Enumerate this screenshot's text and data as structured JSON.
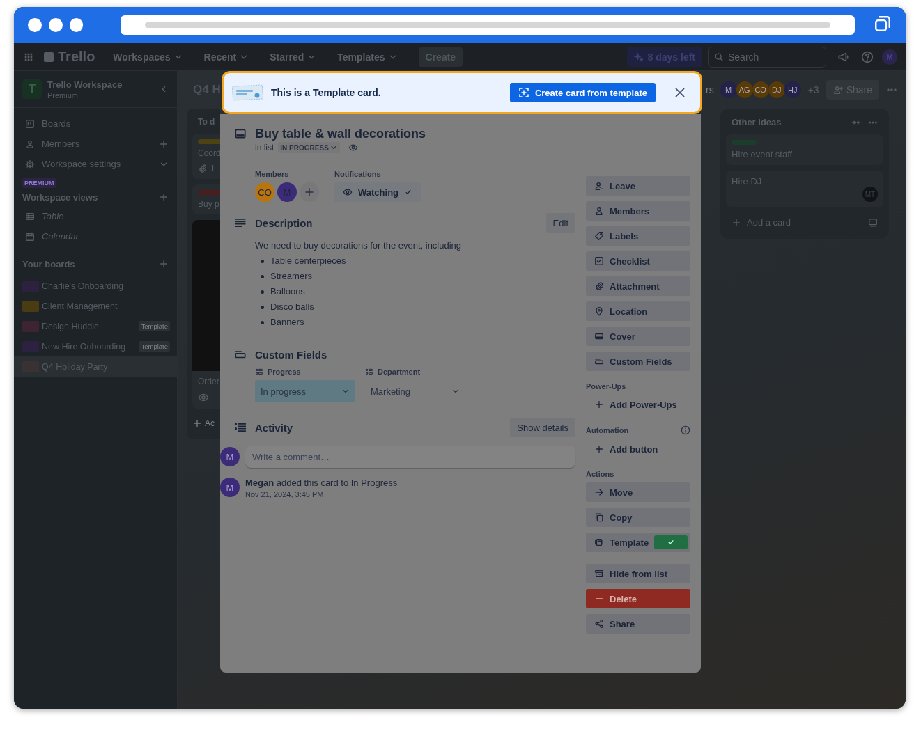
{
  "header": {
    "logo": "Trello",
    "nav": [
      {
        "label": "Workspaces"
      },
      {
        "label": "Recent"
      },
      {
        "label": "Starred"
      },
      {
        "label": "Templates"
      }
    ],
    "create": "Create",
    "trial": "8 days left",
    "search_placeholder": "Search",
    "avatar": "M"
  },
  "sidebar": {
    "workspace": {
      "initial": "T",
      "name": "Trello Workspace",
      "plan": "Premium"
    },
    "items": [
      {
        "label": "Boards",
        "kind": "plain"
      },
      {
        "label": "Members",
        "kind": "add"
      },
      {
        "label": "Workspace settings",
        "kind": "expand"
      }
    ],
    "premium_badge": "PREMIUM",
    "views": {
      "title": "Workspace views",
      "items": [
        {
          "label": "Table"
        },
        {
          "label": "Calendar"
        }
      ]
    },
    "boards": {
      "title": "Your boards",
      "items": [
        {
          "name": "Charlie's Onboarding",
          "color": "#2c2240",
          "selected": false
        },
        {
          "name": "Client Management",
          "color": "#4a3c12",
          "selected": false
        },
        {
          "name": "Design Huddle",
          "color": "#3c2432",
          "tag": "Template",
          "selected": false
        },
        {
          "name": "New Hire Onboarding",
          "color": "#2c2240",
          "tag": "Template",
          "selected": false
        },
        {
          "name": "Q4 Holiday Party",
          "color": "#3a3232",
          "selected": true
        }
      ]
    }
  },
  "board": {
    "title": "Q4 H",
    "toolbar_fragment": "rs",
    "members": [
      {
        "initials": "M",
        "color": "#24214a"
      },
      {
        "initials": "AG",
        "color": "#5a3a06"
      },
      {
        "initials": "CO",
        "color": "#5a3a06"
      },
      {
        "initials": "DJ",
        "color": "#5a3a06"
      },
      {
        "initials": "HJ",
        "color": "#24214a"
      }
    ],
    "more_members": "+3",
    "share": "Share",
    "lists": [
      {
        "title": "To d",
        "cards": [
          {
            "title": "Coord",
            "color": "#4d4312",
            "attachments": "1"
          },
          {
            "title": "Buy p",
            "color": "#4a1e1e"
          },
          {
            "title": "Order",
            "cover": true,
            "watching": true
          }
        ],
        "add": "Ac"
      },
      {
        "title": "Other Ideas",
        "cards": [
          {
            "title": "Hire event staff",
            "color": "#1b3d2b"
          },
          {
            "title": "Hire DJ",
            "member": "MT"
          }
        ],
        "add": "Add a card"
      }
    ]
  },
  "modal": {
    "banner": {
      "text": "This is a Template card.",
      "button": "Create card from template"
    },
    "title": "Buy table & wall decorations",
    "in_list": {
      "prefix": "in list",
      "list": "IN PROGRESS"
    },
    "members_label": "Members",
    "members": [
      {
        "initials": "CO",
        "color": "#b8740f"
      },
      {
        "initials": "M",
        "color": "#3b2b78"
      }
    ],
    "notifications_label": "Notifications",
    "watching": "Watching",
    "description": {
      "heading": "Description",
      "edit": "Edit",
      "intro": "We need to buy decorations for the event, including",
      "bullets": [
        "Table centerpieces",
        "Streamers",
        "Balloons",
        "Disco balls",
        "Banners"
      ]
    },
    "custom_fields": {
      "heading": "Custom Fields",
      "fields": [
        {
          "label": "Progress",
          "value": "In progress",
          "color": "#5f7a82"
        },
        {
          "label": "Department",
          "value": "Marketing"
        }
      ]
    },
    "activity": {
      "heading": "Activity",
      "show_details": "Show details",
      "avatar": "M",
      "comment_placeholder": "Write a comment…",
      "entries": [
        {
          "avatar": "M",
          "text": "**Megan** added this card to In Progress",
          "time": "Nov 21, 2024, 3:45 PM"
        }
      ]
    },
    "sections": [
      {
        "items": [
          {
            "label": "Leave",
            "kind": "button"
          },
          {
            "label": "Members",
            "kind": "button"
          },
          {
            "label": "Labels",
            "kind": "button"
          },
          {
            "label": "Checklist",
            "kind": "button"
          },
          {
            "label": "Attachment",
            "kind": "button"
          },
          {
            "label": "Location",
            "kind": "button"
          },
          {
            "label": "Cover",
            "kind": "button"
          },
          {
            "label": "Custom Fields",
            "kind": "button"
          }
        ]
      },
      {
        "title": "Power-Ups",
        "items": [
          {
            "label": "Add Power-Ups",
            "kind": "add"
          }
        ]
      },
      {
        "title": "Automation",
        "info": true,
        "items": [
          {
            "label": "Add button",
            "kind": "add"
          }
        ]
      },
      {
        "title": "Actions",
        "items": [
          {
            "label": "Move",
            "kind": "button"
          },
          {
            "label": "Copy",
            "kind": "button"
          },
          {
            "label": "Template",
            "kind": "button",
            "checked": true
          },
          {
            "kind": "divider"
          },
          {
            "label": "Hide from list",
            "kind": "button"
          },
          {
            "label": "Delete",
            "kind": "danger"
          },
          {
            "label": "Share",
            "kind": "button"
          }
        ]
      }
    ]
  }
}
